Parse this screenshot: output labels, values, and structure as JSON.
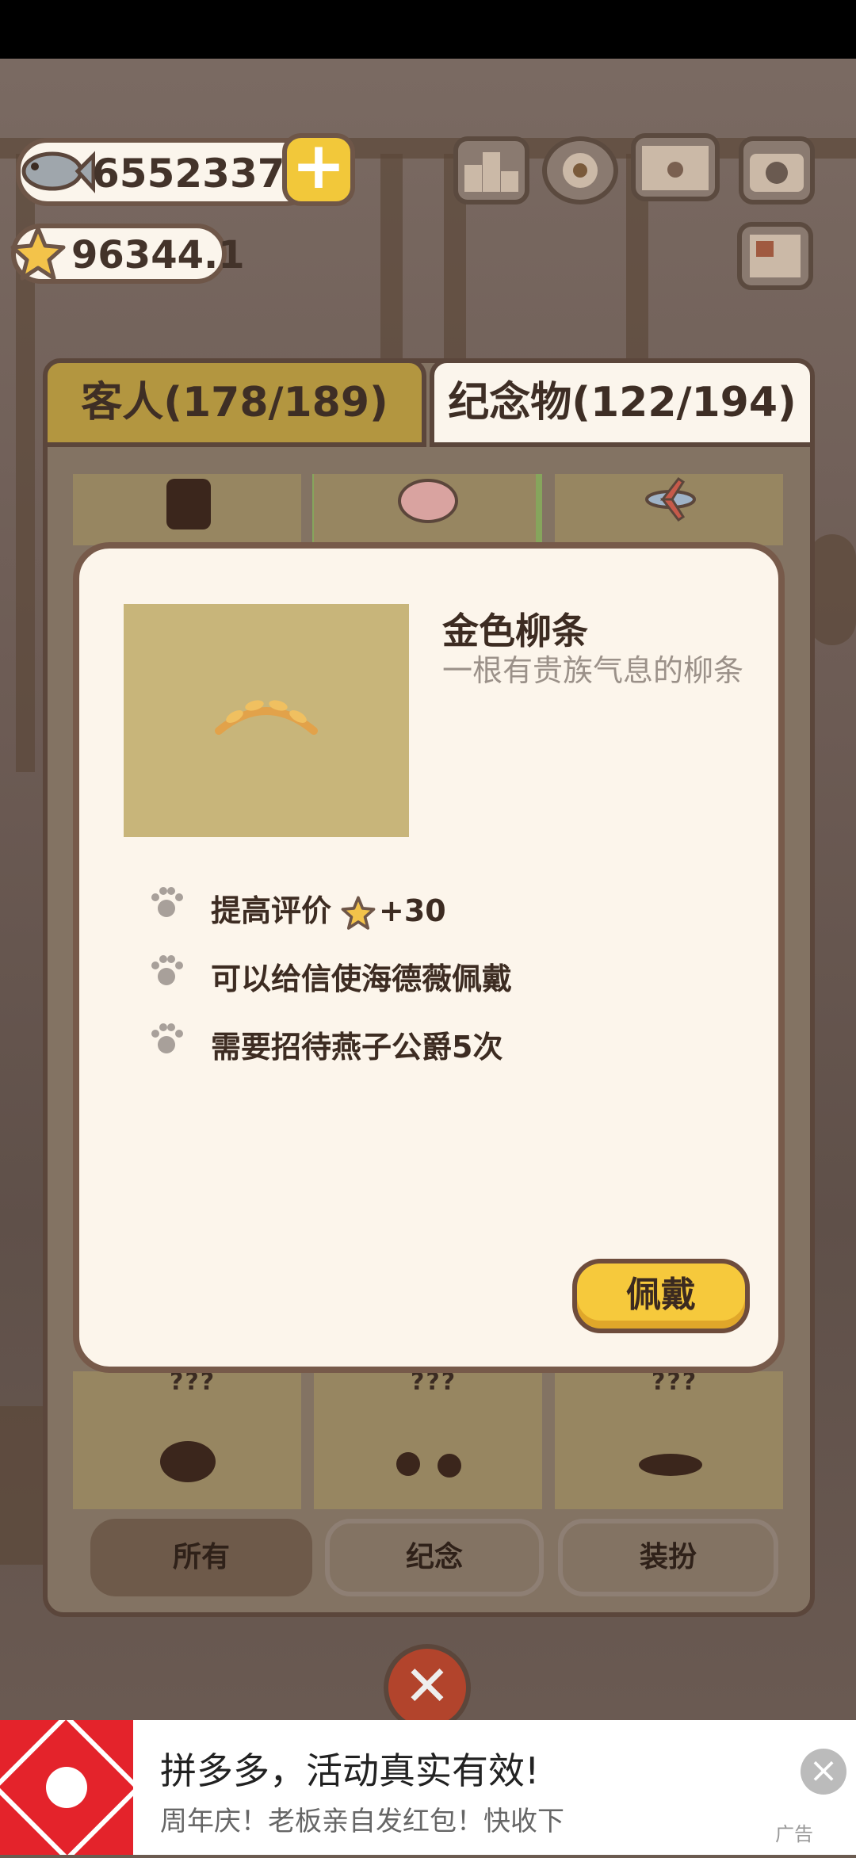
{
  "hud": {
    "fish_count": "6552337",
    "star_count": "96344.1",
    "add_label": "+"
  },
  "tabs": {
    "guests": "客人(178/189)",
    "souvenirs": "纪念物(122/194)"
  },
  "grid": {
    "unknown_label": "???"
  },
  "item": {
    "name": "金色柳条",
    "description": "一根有贵族气息的柳条",
    "features": [
      {
        "text": "提高评价",
        "bonus": "+30"
      },
      {
        "text": "可以给信使海德薇佩戴"
      },
      {
        "text": "需要招待燕子公爵5次"
      }
    ],
    "equip_label": "佩戴"
  },
  "filters": [
    "所有",
    "纪念",
    "装扮"
  ],
  "close_label": "✕",
  "ad": {
    "title": "拼多多，活动真实有效!",
    "subtitle": "周年庆！老板亲自发红包！快收下",
    "tag": "广告",
    "close": "×"
  },
  "colors": {
    "accent_yellow": "#f6c93c",
    "panel_brown": "#5b463b",
    "tab_gold": "#b39640",
    "dialog_bg": "#fcf5eb",
    "ad_red": "#e4232b"
  }
}
